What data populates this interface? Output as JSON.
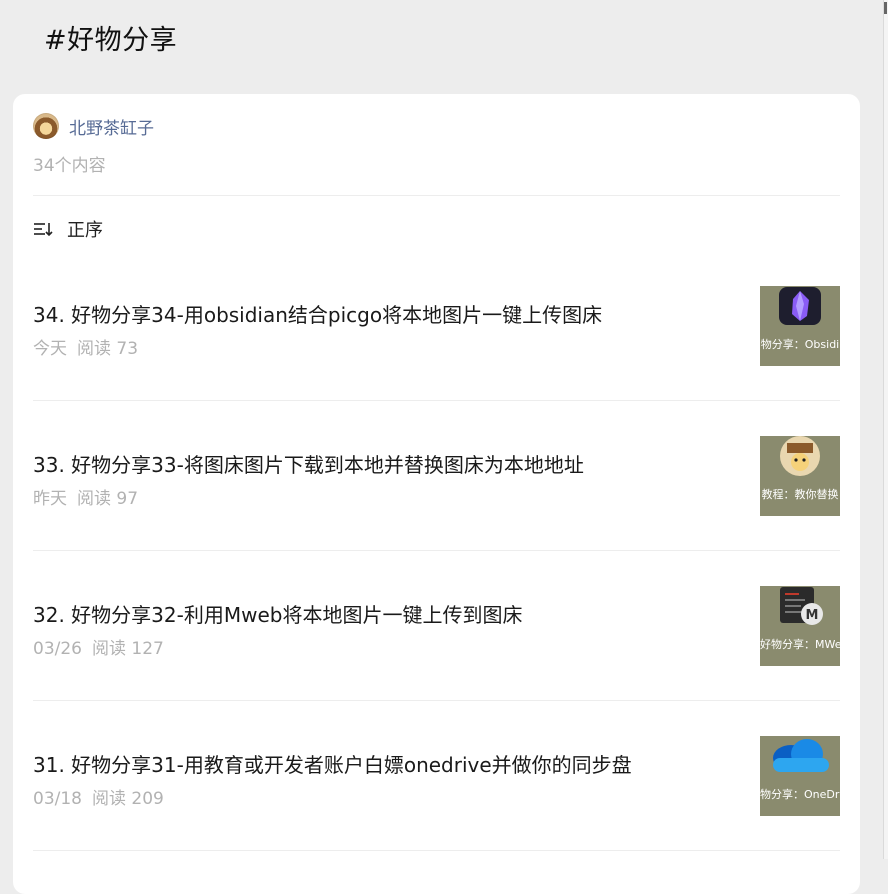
{
  "header": {
    "title": "#好物分享"
  },
  "author": {
    "name": "北野茶缸子",
    "count": "34个内容"
  },
  "sort": {
    "label": "正序",
    "icon": "sort-order-icon"
  },
  "items": [
    {
      "title": "34. 好物分享34-用obsidian结合picgo将本地图片一键上传图床",
      "date": "今天",
      "reads": "阅读 73",
      "thumb_caption": "物分享：Obsidi",
      "thumb_icon": "obsidian-icon"
    },
    {
      "title": "33. 好物分享33-将图床图片下载到本地并替换图床为本地地址",
      "date": "昨天",
      "reads": "阅读 97",
      "thumb_caption": "教程：教你替换",
      "thumb_icon": "avatar-icon"
    },
    {
      "title": "32. 好物分享32-利用Mweb将本地图片一键上传到图床",
      "date": "03/26",
      "reads": "阅读 127",
      "thumb_caption": "好物分享：MWeb",
      "thumb_icon": "mweb-icon"
    },
    {
      "title": "31. 好物分享31-用教育或开发者账户白嫖onedrive并做你的同步盘",
      "date": "03/18",
      "reads": "阅读 209",
      "thumb_caption": "物分享：OneDri",
      "thumb_icon": "onedrive-icon"
    }
  ]
}
